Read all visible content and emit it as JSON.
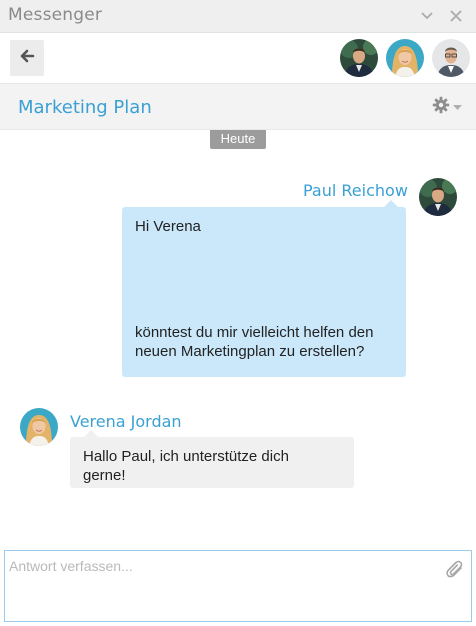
{
  "window": {
    "title": "Messenger",
    "minimize_icon": "chevron-down-icon",
    "close_icon": "close-icon"
  },
  "header": {
    "back_icon": "arrow-left-icon",
    "participants": [
      {
        "role": "participant",
        "tone": "#34495e"
      },
      {
        "role": "participant",
        "tone": "#e9b66a"
      },
      {
        "role": "participant",
        "tone": "#7d8a96"
      }
    ]
  },
  "conversation": {
    "title": "Marketing Plan",
    "settings_icon": "gear-icon"
  },
  "chat": {
    "date_label": "Heute",
    "messages": [
      {
        "author": "Paul Reichow",
        "direction": "outgoing",
        "lines_top": "Hi Verena",
        "lines_bottom_1": "könntest du mir vielleicht helfen den",
        "lines_bottom_2": "neuen Marketingplan zu erstellen?"
      },
      {
        "author": "Verena Jordan",
        "direction": "incoming",
        "line_1": "Hallo Paul, ich unterstütze dich",
        "line_2": "gerne!"
      }
    ]
  },
  "composer": {
    "placeholder": "Antwort verfassen...",
    "value": "",
    "attach_icon": "paperclip-icon"
  },
  "colors": {
    "accent": "#3aa0d3",
    "outgoing_bubble": "#cbe8fb",
    "incoming_bubble": "#f0f0f0",
    "date_badge": "#9c9c9c"
  }
}
